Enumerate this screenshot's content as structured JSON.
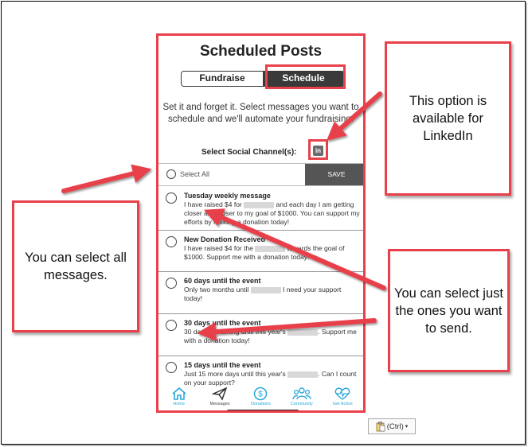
{
  "page_title": "Scheduled Posts",
  "tabs": [
    {
      "label": "Fundraise",
      "active": false
    },
    {
      "label": "Schedule",
      "active": true
    }
  ],
  "description": "Set it and forget it. Select messages you want to schedule and we'll automate your fundraising.",
  "social_channel_label": "Select Social Channel(s):",
  "social_channel_icon": "linkedin-icon",
  "social_channel_icon_text": "in",
  "select_all_label": "Select All",
  "save_label": "SAVE",
  "messages": [
    {
      "title": "Tuesday weekly message",
      "body_before": "I have raised $4 for",
      "body_after": "and each day I am getting closer and closer to my goal of $1000. You can support my efforts by making a donation today!"
    },
    {
      "title": "New Donation Received",
      "body_before": "I have raised $4 for the",
      "body_after": "towards the goal of $1000. Support me with a donation today!"
    },
    {
      "title": "60 days until the event",
      "body_before": "Only two months until",
      "body_after": "I need your support today!"
    },
    {
      "title": "30 days until the event",
      "body_before": "30 days remaining until this year's",
      "body_after": ". Support me with a donation today!"
    },
    {
      "title": "15 days until the event",
      "body_before": "Just 15 more days until this year's",
      "body_after": ". Can I count on your support?"
    }
  ],
  "nav": [
    {
      "label": "Home",
      "icon": "home-icon"
    },
    {
      "label": "Messages",
      "icon": "paper-plane-icon"
    },
    {
      "label": "Donations",
      "icon": "dollar-icon"
    },
    {
      "label": "Community",
      "icon": "community-icon"
    },
    {
      "label": "Get Active",
      "icon": "heart-pulse-icon"
    }
  ],
  "callouts": {
    "linkedin": "This option is available for LinkedIn",
    "select_all": "You can select all messages.",
    "select_some": "You can select just the ones you want to send."
  },
  "paste_options": {
    "label": "(Ctrl)",
    "icon": "clipboard-icon",
    "dropdown_icon": "chevron-down-icon"
  },
  "colors": {
    "accent_red": "#e8414b",
    "nav_blue": "#2aa7d9",
    "dark_button": "#3a3a3a"
  }
}
